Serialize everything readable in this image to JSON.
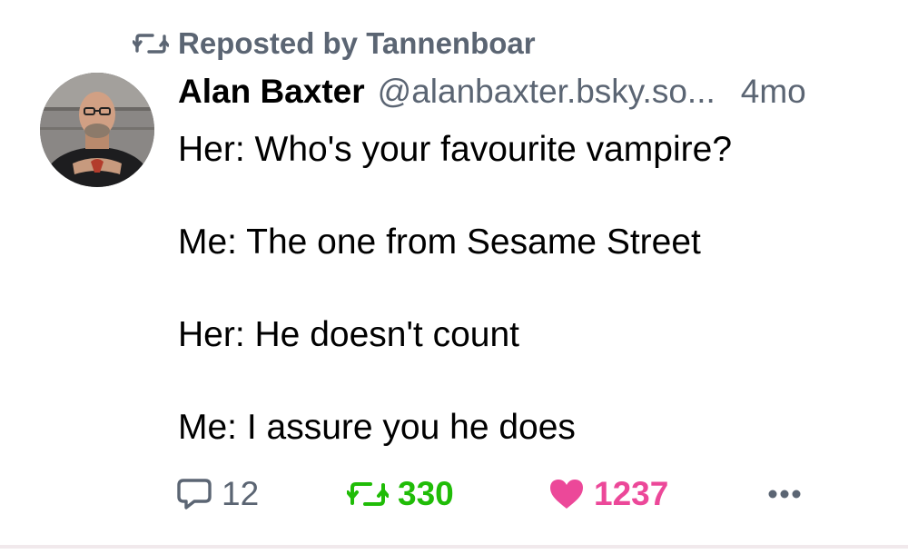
{
  "repost": {
    "text": "Reposted by Tannenboar",
    "icon": "repost-icon"
  },
  "author": {
    "name": "Alan Baxter",
    "handle": "@alanbaxter.bsky.so...",
    "age": "4mo",
    "avatar": "avatar-photo"
  },
  "post": {
    "lines": [
      "Her: Who's your favourite vampire?",
      "Me: The one from Sesame Street",
      "Her: He doesn't count",
      "Me: I assure you he does"
    ]
  },
  "actions": {
    "reply": {
      "count": "12",
      "icon": "reply-icon"
    },
    "repost": {
      "count": "330",
      "icon": "repost-icon"
    },
    "like": {
      "count": "1237",
      "icon": "heart-icon"
    },
    "more": {
      "icon": "more-icon"
    }
  },
  "colors": {
    "muted": "#5b6573",
    "repost_active": "#20bc07",
    "like_active": "#ec4899"
  }
}
